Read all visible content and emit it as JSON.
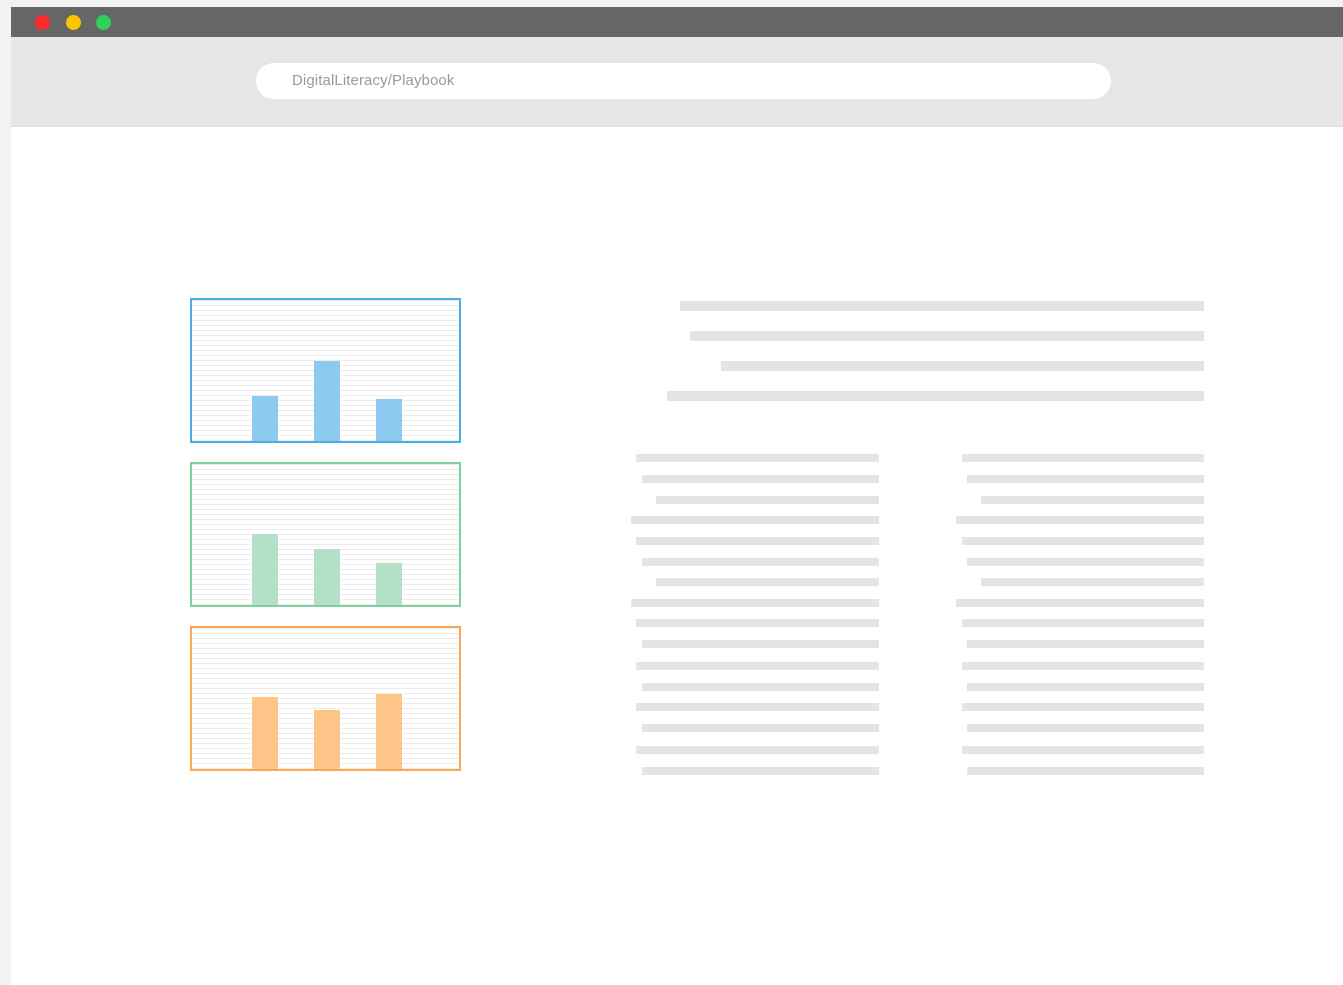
{
  "window": {
    "controls": [
      {
        "name": "close",
        "color": "#ff2a2a"
      },
      {
        "name": "minimize",
        "color": "#ffc400"
      },
      {
        "name": "maximize",
        "color": "#2ed15a"
      }
    ]
  },
  "address_bar": {
    "url": "DigitalLiteracy/Playbook"
  },
  "charts": [
    {
      "color": "#8ecaef",
      "border": "#4aaee6",
      "values": [
        0.32,
        0.57,
        0.3
      ]
    },
    {
      "color": "#b3e0c6",
      "border": "#7fcf9f",
      "values": [
        0.5,
        0.4,
        0.3
      ]
    },
    {
      "color": "#ffc488",
      "border": "#ffa651",
      "values": [
        0.51,
        0.42,
        0.53
      ]
    }
  ],
  "colors": {
    "titlebar": "#666666",
    "toolbar": "#e6e6e6",
    "placeholder_text": "#e4e4e4"
  }
}
